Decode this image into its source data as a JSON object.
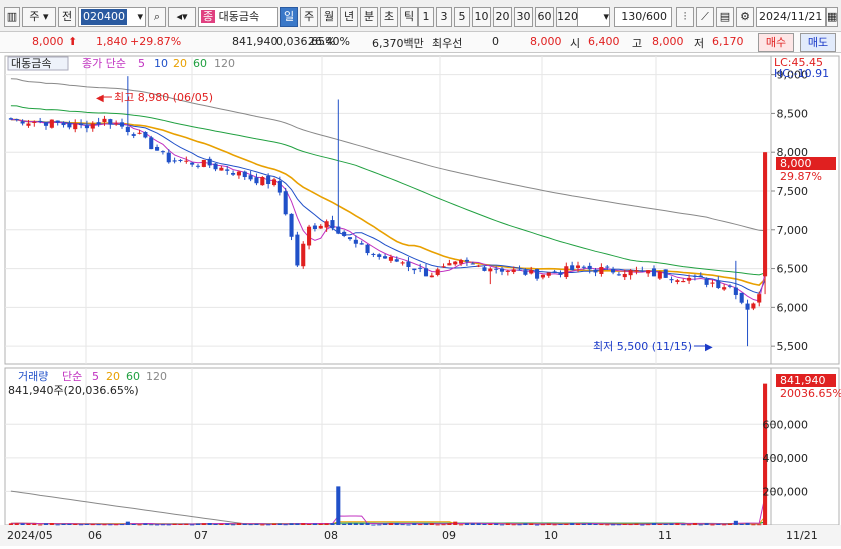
{
  "toolbar": {
    "market": "주",
    "prev_label": "전",
    "code": "020400",
    "stock_name_badge": "종",
    "stock_name": "대동금속",
    "periods": [
      "일",
      "주",
      "월",
      "년",
      "분",
      "초",
      "틱"
    ],
    "selected_period": "일",
    "intervals": [
      "1",
      "3",
      "5",
      "10",
      "20",
      "30",
      "60",
      "120"
    ],
    "count": "130",
    "count_total": "/600",
    "date": "2024/11/21"
  },
  "quote": {
    "price": "8,000",
    "change": "1,840",
    "change_pct": "+29.87%",
    "volume": "841,940",
    "volume_pct": "0,036.65%",
    "turnover": "26.40%",
    "amount": "6,370백만",
    "pref_label": "최우선",
    "pref_value": "0",
    "best_ask": "8,000",
    "open_label": "시",
    "open": "6,400",
    "high_label": "고",
    "high": "8,000",
    "low_label": "저",
    "low": "6,170",
    "buy_label": "매수",
    "sell_label": "매도"
  },
  "price_panel": {
    "name": "대동금속",
    "indicator": "종가 단순",
    "ma_periods": [
      "5",
      "10",
      "20",
      "60",
      "120"
    ],
    "lc": "LC:45.45",
    "hc": "HC:-10.91",
    "high_note": "최고 8,980 (06/05)",
    "low_note": "최저 5,500 (11/15)",
    "last_price_label": "8,000",
    "last_pct_label": "29.87%"
  },
  "volume_panel": {
    "name": "거래량",
    "indicator": "단순",
    "ma_periods": [
      "5",
      "20",
      "60",
      "120"
    ],
    "summary": "841,940주(20,036.65%)",
    "last_label": "841,940",
    "last_pct_label": "20036.65%"
  },
  "colors": {
    "up": "#e02020",
    "down": "#2050c8",
    "ma5": "#c030c0",
    "ma10": "#2050c8",
    "ma20": "#e8a000",
    "ma60": "#20a040",
    "ma120": "#888888"
  },
  "chart_data": {
    "type": "candlestick",
    "price_axis": {
      "ticks": [
        5500,
        6000,
        6500,
        7000,
        7500,
        8000,
        8500,
        9000
      ],
      "labels": [
        "5,500",
        "6,000",
        "6,500",
        "7,000",
        "7,500",
        "8,000",
        "8,500",
        "9,000"
      ]
    },
    "volume_axis": {
      "ticks": [
        200000,
        400000,
        600000
      ],
      "labels": [
        "200,000",
        "400,000",
        "600,000"
      ]
    },
    "x_axis_labels": [
      "2024/05",
      "06",
      "07",
      "08",
      "09",
      "10",
      "11",
      "11/21"
    ],
    "high": {
      "value": 8980,
      "date": "06/05"
    },
    "low": {
      "value": 5500,
      "date": "11/15"
    },
    "last": {
      "price": 8000,
      "change_pct": 29.87,
      "volume": 841940
    }
  }
}
